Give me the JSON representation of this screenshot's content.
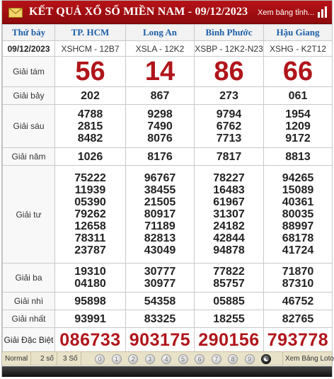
{
  "header": {
    "title": "KẾT QUẢ XỔ SỐ MIỀN NAM - 09/12/2023",
    "view_link": "Xem bảng tỉnh...",
    "mail_icon": "envelope-icon",
    "chart_icon": "bar-chart-icon"
  },
  "table": {
    "day": "Thứ bảy",
    "date": "09/12/2023",
    "provinces": [
      {
        "name": "TP. HCM",
        "code": "XSHCM - 12B7"
      },
      {
        "name": "Long An",
        "code": "XSLA - 12K2"
      },
      {
        "name": "Bình Phước",
        "code": "XSBP - 12K2-N23"
      },
      {
        "name": "Hậu Giang",
        "code": "XSHG - K2T12"
      }
    ],
    "prizes": [
      {
        "label": "Giải tám",
        "results": [
          [
            "56"
          ],
          [
            "14"
          ],
          [
            "86"
          ],
          [
            "66"
          ]
        ]
      },
      {
        "label": "Giải bảy",
        "results": [
          [
            "202"
          ],
          [
            "867"
          ],
          [
            "273"
          ],
          [
            "061"
          ]
        ]
      },
      {
        "label": "Giải sáu",
        "results": [
          [
            "4788",
            "2815",
            "8482"
          ],
          [
            "9298",
            "7490",
            "8076"
          ],
          [
            "9794",
            "6762",
            "7713"
          ],
          [
            "1954",
            "1209",
            "9172"
          ]
        ]
      },
      {
        "label": "Giải năm",
        "results": [
          [
            "1026"
          ],
          [
            "8176"
          ],
          [
            "7817"
          ],
          [
            "8813"
          ]
        ]
      },
      {
        "label": "Giải tư",
        "results": [
          [
            "75222",
            "11939",
            "05390",
            "79262",
            "12658",
            "78311",
            "23787"
          ],
          [
            "96767",
            "38455",
            "21505",
            "80917",
            "71189",
            "82813",
            "43049"
          ],
          [
            "78227",
            "16483",
            "61967",
            "31307",
            "24182",
            "42844",
            "94878"
          ],
          [
            "94265",
            "15089",
            "40361",
            "80035",
            "88997",
            "68178",
            "41724"
          ]
        ]
      },
      {
        "label": "Giải ba",
        "results": [
          [
            "19310",
            "04180"
          ],
          [
            "30777",
            "30977"
          ],
          [
            "77822",
            "85757"
          ],
          [
            "71870",
            "87310"
          ]
        ]
      },
      {
        "label": "Giải nhì",
        "results": [
          [
            "95898"
          ],
          [
            "54358"
          ],
          [
            "05885"
          ],
          [
            "46752"
          ]
        ]
      },
      {
        "label": "Giải nhất",
        "results": [
          [
            "93991"
          ],
          [
            "83325"
          ],
          [
            "18255"
          ],
          [
            "82765"
          ]
        ]
      },
      {
        "label": "Giải Đặc Biệt",
        "results": [
          [
            "086733"
          ],
          [
            "903175"
          ],
          [
            "290156"
          ],
          [
            "793778"
          ]
        ]
      }
    ]
  },
  "footer": {
    "normal": "Normal",
    "two_digits": "2 số",
    "three_digits": "3 Số",
    "digits": [
      "0",
      "1",
      "2",
      "3",
      "4",
      "5",
      "6",
      "7",
      "8",
      "9"
    ],
    "loto_link": "Xem Bảng Loto"
  },
  "colors": {
    "header_red": "#a80f13",
    "prize_red": "#b0151b",
    "province_blue": "#1c5fa8",
    "footer_bg": "#e8e2c9"
  }
}
